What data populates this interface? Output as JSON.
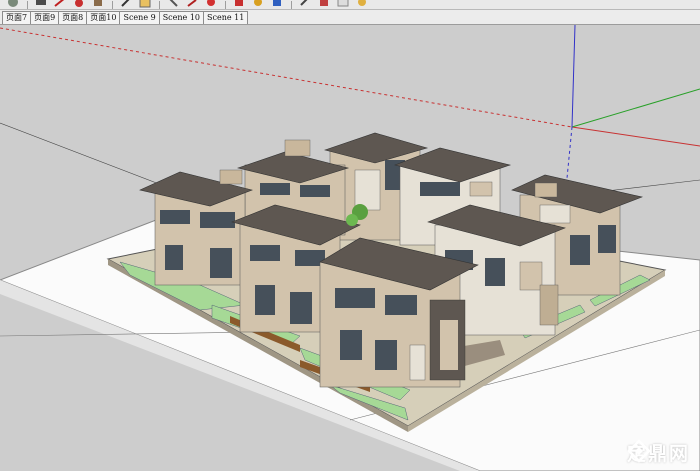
{
  "toolbar": {
    "icons": [
      "circle-tool-icon",
      "pencil-icon",
      "arrow-icon",
      "select-icon",
      "paint-bucket-icon",
      "push-pull-icon",
      "orbit-icon",
      "pan-icon",
      "zoom-icon",
      "walk-icon",
      "section-icon",
      "layer-icon"
    ]
  },
  "scene_tabs": [
    "页面7",
    "页面9",
    "页面8",
    "页面10",
    "Scene 9",
    "Scene 10",
    "Scene 11"
  ],
  "watermark": {
    "text": "定鼎网"
  },
  "colors": {
    "background": "#cdcdcd",
    "ground": "#ffffff",
    "roof": "#5e5751",
    "wall": "#d2c3ac",
    "lawn": "#a6d996",
    "axis_red": "#c83232",
    "axis_green": "#28a028",
    "axis_blue": "#3232c8"
  }
}
